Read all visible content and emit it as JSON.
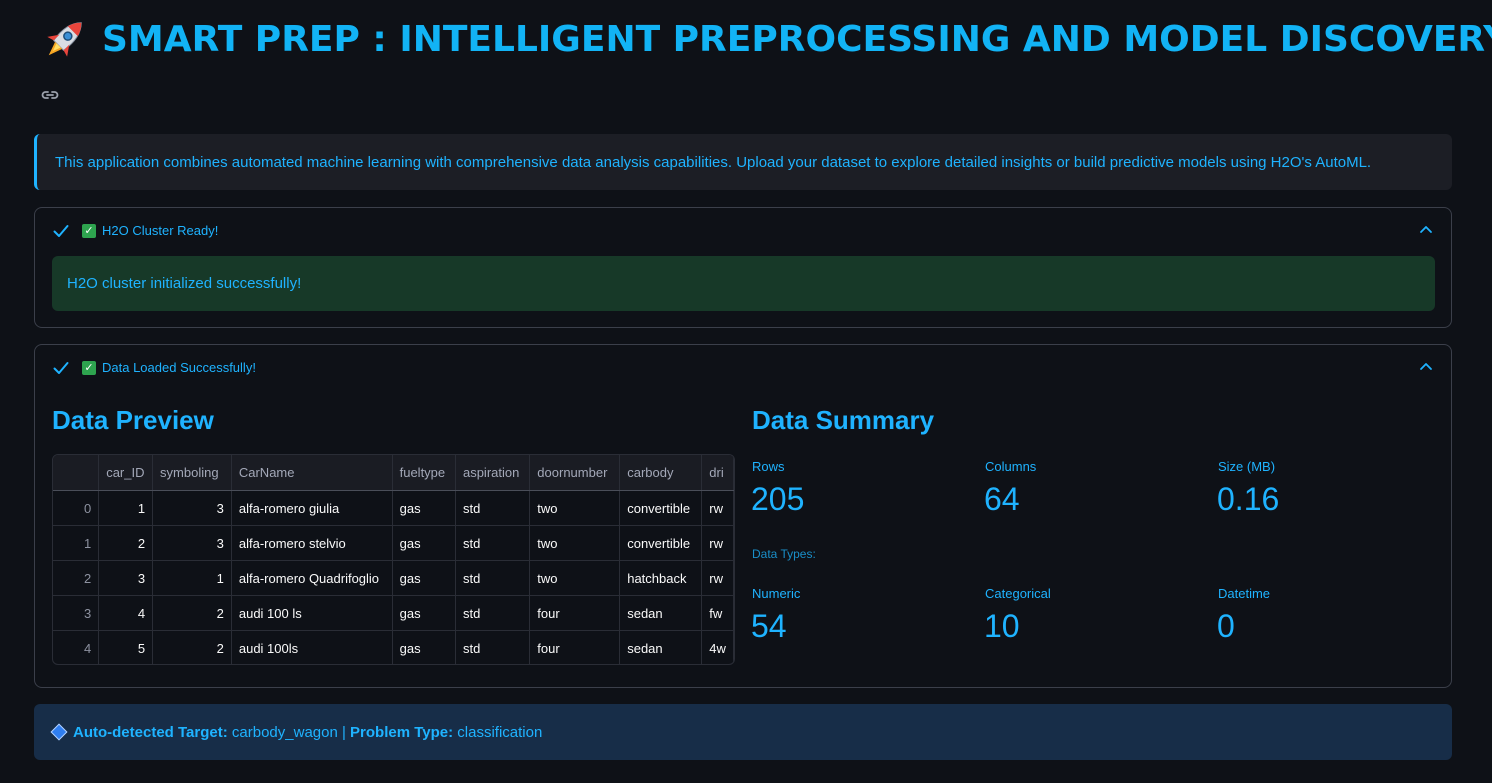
{
  "header": {
    "title": "SMART PREP : INTELLIGENT PREPROCESSING AND MODEL DISCOVERY"
  },
  "info": {
    "text": "This application combines automated machine learning with comprehensive data analysis capabilities. Upload your dataset to explore detailed insights or build predictive models using H2O's AutoML."
  },
  "cluster_expander": {
    "label": "H2O Cluster Ready!",
    "message": "H2O cluster initialized successfully!"
  },
  "data_expander": {
    "label": "Data Loaded Successfully!"
  },
  "preview": {
    "heading": "Data Preview",
    "columns": [
      "",
      "car_ID",
      "symboling",
      "CarName",
      "fueltype",
      "aspiration",
      "doornumber",
      "carbody",
      "dri"
    ],
    "rows": [
      [
        "0",
        "1",
        "3",
        "alfa-romero giulia",
        "gas",
        "std",
        "two",
        "convertible",
        "rw"
      ],
      [
        "1",
        "2",
        "3",
        "alfa-romero stelvio",
        "gas",
        "std",
        "two",
        "convertible",
        "rw"
      ],
      [
        "2",
        "3",
        "1",
        "alfa-romero Quadrifoglio",
        "gas",
        "std",
        "two",
        "hatchback",
        "rw"
      ],
      [
        "3",
        "4",
        "2",
        "audi 100 ls",
        "gas",
        "std",
        "four",
        "sedan",
        "fw"
      ],
      [
        "4",
        "5",
        "2",
        "audi 100ls",
        "gas",
        "std",
        "four",
        "sedan",
        "4w"
      ]
    ]
  },
  "summary": {
    "heading": "Data Summary",
    "rows_label": "Rows",
    "rows_value": "205",
    "columns_label": "Columns",
    "columns_value": "64",
    "size_label": "Size (MB)",
    "size_value": "0.16",
    "dtypes_label": "Data Types:",
    "numeric_label": "Numeric",
    "numeric_value": "54",
    "categorical_label": "Categorical",
    "categorical_value": "10",
    "datetime_label": "Datetime",
    "datetime_value": "0"
  },
  "target": {
    "target_label": "Auto-detected Target:",
    "target_value": " carbody_wagon | ",
    "problem_label": "Problem Type:",
    "problem_value": " classification"
  },
  "icons": {
    "rocket": "rocket-icon",
    "link": "link-icon",
    "check": "check-icon",
    "checkbox": "green-check-box-icon",
    "chevron": "chevron-up-icon",
    "diamond": "blue-diamond-icon"
  },
  "colors": {
    "accent": "#1fb3ff",
    "background": "#0e1117",
    "success_bg": "#173928",
    "target_bg": "#172d48"
  }
}
